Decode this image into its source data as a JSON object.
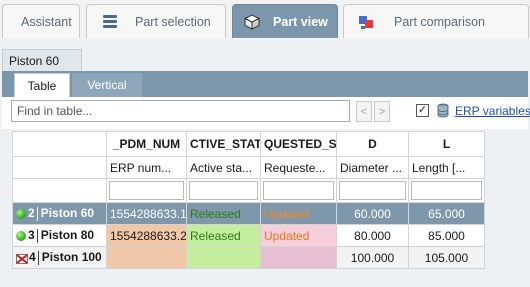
{
  "tabs": {
    "assistant": "Assistant",
    "part_selection": "Part selection",
    "part_view": "Part view",
    "part_comparison": "Part comparison"
  },
  "part_tab": "Piston 60",
  "view_tabs": {
    "table": "Table",
    "vertical": "Vertical"
  },
  "toolbar": {
    "find_placeholder": "Find in table...",
    "prev": "<",
    "next": ">",
    "erp_checked": true,
    "erp_label": "ERP variables"
  },
  "columns": [
    {
      "header": "_PDM_NUM",
      "sub": "ERP num..."
    },
    {
      "header": "CTIVE_STAT",
      "sub": "Active sta..."
    },
    {
      "header": "QUESTED_ST.",
      "sub": "Requeste..."
    },
    {
      "header": "D",
      "sub": "Diameter ..."
    },
    {
      "header": "L",
      "sub": "Length [..."
    }
  ],
  "rows": [
    {
      "num": "2",
      "name": "Piston 60",
      "icon": "green-status-icon",
      "erp": "1554288633.1",
      "active": "Released",
      "requested": "Updated",
      "d": "60.000",
      "l": "65.000"
    },
    {
      "num": "3",
      "name": "Piston 80",
      "icon": "green-status-icon",
      "erp": "1554288633.2",
      "active": "Released",
      "requested": "Updated",
      "d": "80.000",
      "l": "85.000"
    },
    {
      "num": "4",
      "name": "Piston 100",
      "icon": "error-status-icon",
      "erp": "",
      "active": "",
      "requested": "",
      "d": "100.000",
      "l": "105.000"
    }
  ],
  "colors": {
    "selected_row": "#7e97ab",
    "erp_cell": "#f0c8a8",
    "active_cell": "#c4ee9e",
    "requested_cell": "#f7cfdc",
    "row4_requested": "#e6bfd2"
  }
}
